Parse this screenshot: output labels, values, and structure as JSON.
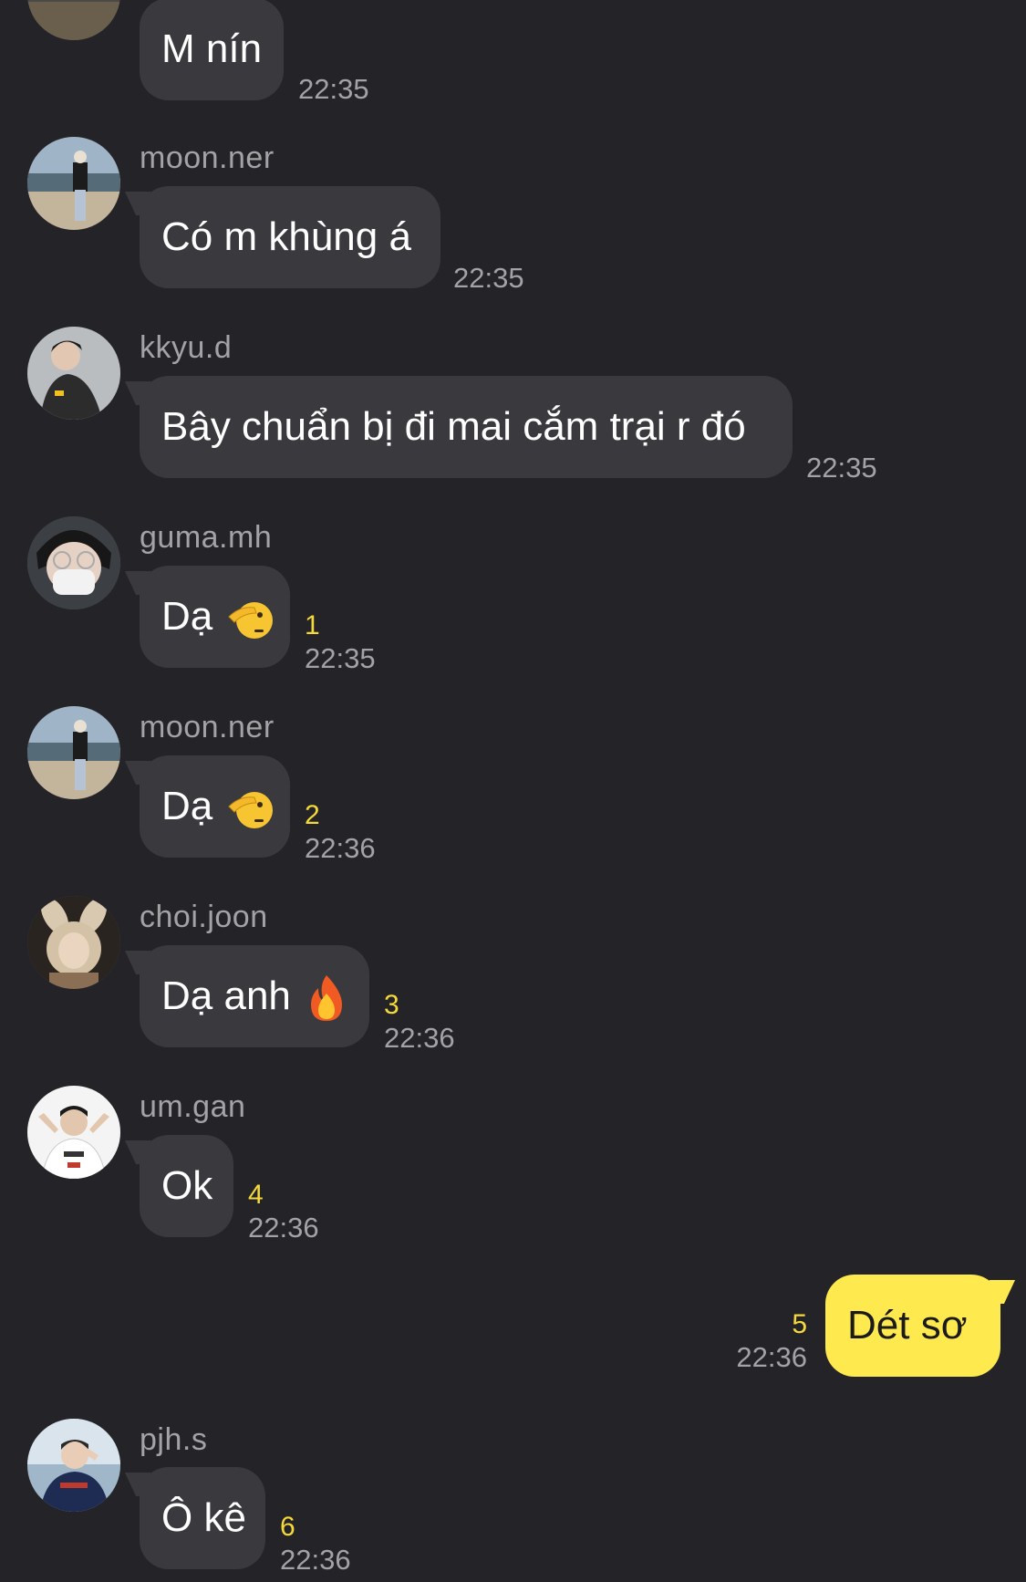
{
  "messages": [
    {
      "text": "M nín",
      "time": "22:35"
    },
    {
      "sender": "moon.ner",
      "text": "Có m khùng á",
      "time": "22:35"
    },
    {
      "sender": "kkyu.d",
      "text": "Bây chuẩn bị đi mai cắm trại r đó",
      "time": "22:35"
    },
    {
      "sender": "guma.mh",
      "text": "Dạ",
      "emoji": "saluting-face-icon",
      "count": "1",
      "time": "22:35"
    },
    {
      "sender": "moon.ner",
      "text": "Dạ",
      "emoji": "saluting-face-icon",
      "count": "2",
      "time": "22:36"
    },
    {
      "sender": "choi.joon",
      "text": "Dạ anh",
      "emoji": "fire-icon",
      "count": "3",
      "time": "22:36"
    },
    {
      "sender": "um.gan",
      "text": "Ok",
      "count": "4",
      "time": "22:36"
    },
    {
      "own": true,
      "text": "Dét sơ",
      "count": "5",
      "time": "22:36"
    },
    {
      "sender": "pjh.s",
      "text": "Ô kê",
      "count": "6",
      "time": "22:36"
    }
  ],
  "colors": {
    "background": "#242428",
    "bubble_other": "#3a3a3e",
    "bubble_own": "#fee94e",
    "unread_count": "#f5d93a",
    "meta_text": "#a3a3a6"
  }
}
